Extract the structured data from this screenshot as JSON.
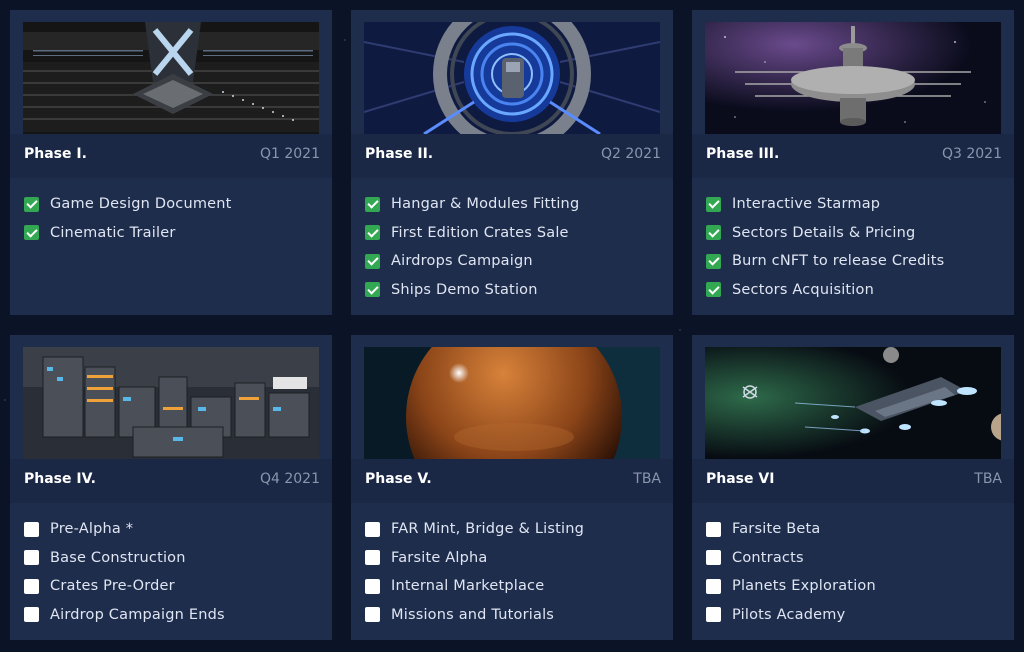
{
  "colors": {
    "page_bg": "#0b1426",
    "card_bg": "#1f2d4d",
    "card_header_bg": "#1a2745",
    "check_green": "#32a852",
    "date_gray": "#8a96ae"
  },
  "phases": [
    {
      "title": "Phase I.",
      "when": "Q1 2021",
      "image": "space-station-interior-image",
      "items": [
        {
          "label": "Game Design Document",
          "checked": true
        },
        {
          "label": "Cinematic Trailer",
          "checked": true
        }
      ]
    },
    {
      "title": "Phase II.",
      "when": "Q2 2021",
      "image": "hangar-portal-image",
      "items": [
        {
          "label": "Hangar & Modules Fitting",
          "checked": true
        },
        {
          "label": "First Edition Crates Sale",
          "checked": true
        },
        {
          "label": "Airdrops Campaign",
          "checked": true
        },
        {
          "label": "Ships Demo Station",
          "checked": true
        }
      ]
    },
    {
      "title": "Phase III.",
      "when": "Q3 2021",
      "image": "orbital-station-image",
      "items": [
        {
          "label": "Interactive Starmap",
          "checked": true
        },
        {
          "label": "Sectors Details & Pricing",
          "checked": true
        },
        {
          "label": "Burn cNFT to release Credits",
          "checked": true
        },
        {
          "label": "Sectors Acquisition",
          "checked": true
        }
      ]
    },
    {
      "title": "Phase IV.",
      "when": "Q4 2021",
      "image": "base-construction-image",
      "items": [
        {
          "label": "Pre-Alpha *",
          "checked": false
        },
        {
          "label": "Base Construction",
          "checked": false
        },
        {
          "label": "Crates Pre-Order",
          "checked": false
        },
        {
          "label": "Airdrop Campaign Ends",
          "checked": false
        }
      ]
    },
    {
      "title": "Phase V.",
      "when": "TBA",
      "image": "planet-image",
      "items": [
        {
          "label": "FAR Mint, Bridge & Listing",
          "checked": false
        },
        {
          "label": "Farsite Alpha",
          "checked": false
        },
        {
          "label": "Internal Marketplace",
          "checked": false
        },
        {
          "label": "Missions and Tutorials",
          "checked": false
        }
      ]
    },
    {
      "title": "Phase VI",
      "when": "TBA",
      "image": "space-battle-image",
      "items": [
        {
          "label": "Farsite Beta",
          "checked": false
        },
        {
          "label": "Contracts",
          "checked": false
        },
        {
          "label": "Planets Exploration",
          "checked": false
        },
        {
          "label": "Pilots Academy",
          "checked": false
        }
      ]
    }
  ]
}
